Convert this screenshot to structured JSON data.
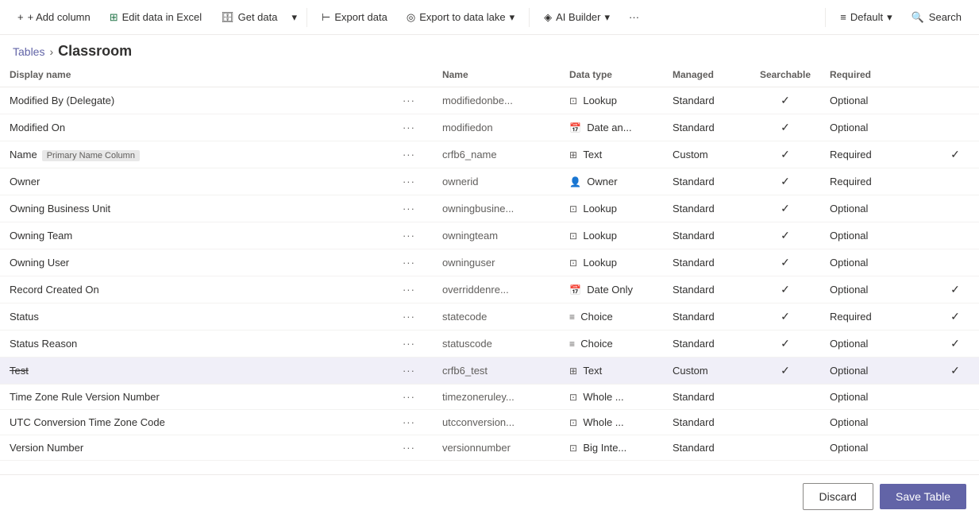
{
  "breadcrumb": {
    "parent": "Tables",
    "separator": "›",
    "current": "Classroom"
  },
  "toolbar": {
    "add_column": "+ Add column",
    "edit_excel": "Edit data in Excel",
    "get_data": "Get data",
    "dropdown": "",
    "export_data": "Export data",
    "export_lake": "Export to data lake",
    "ai_builder": "AI Builder",
    "more": "···",
    "default": "Default",
    "search": "Search"
  },
  "table": {
    "headers": [
      "Display name",
      "",
      "Name",
      "Data type",
      "Managed",
      "Searchable",
      "Required",
      ""
    ],
    "rows": [
      {
        "name": "Modified By (Delegate)",
        "dots": "···",
        "logical": "modifiedonbe...",
        "type_icon": "⊡",
        "type": "Lookup",
        "managed": "Standard",
        "searchable": true,
        "required": "Optional",
        "check2": false,
        "badge": "",
        "strikethrough": false,
        "selected": false
      },
      {
        "name": "Modified On",
        "dots": "···",
        "logical": "modifiedon",
        "type_icon": "📅",
        "type": "Date an...",
        "managed": "Standard",
        "searchable": true,
        "required": "Optional",
        "check2": false,
        "badge": "",
        "strikethrough": false,
        "selected": false
      },
      {
        "name": "Name",
        "dots": "···",
        "logical": "crfb6_name",
        "type_icon": "⊞",
        "type": "Text",
        "managed": "Custom",
        "searchable": true,
        "required": "Required",
        "check2": true,
        "badge": "Primary Name Column",
        "strikethrough": false,
        "selected": false
      },
      {
        "name": "Owner",
        "dots": "···",
        "logical": "ownerid",
        "type_icon": "👤",
        "type": "Owner",
        "managed": "Standard",
        "searchable": true,
        "required": "Required",
        "check2": false,
        "badge": "",
        "strikethrough": false,
        "selected": false
      },
      {
        "name": "Owning Business Unit",
        "dots": "···",
        "logical": "owningbusine...",
        "type_icon": "⊡",
        "type": "Lookup",
        "managed": "Standard",
        "searchable": true,
        "required": "Optional",
        "check2": false,
        "badge": "",
        "strikethrough": false,
        "selected": false
      },
      {
        "name": "Owning Team",
        "dots": "···",
        "logical": "owningteam",
        "type_icon": "⊡",
        "type": "Lookup",
        "managed": "Standard",
        "searchable": true,
        "required": "Optional",
        "check2": false,
        "badge": "",
        "strikethrough": false,
        "selected": false
      },
      {
        "name": "Owning User",
        "dots": "···",
        "logical": "owninguser",
        "type_icon": "⊡",
        "type": "Lookup",
        "managed": "Standard",
        "searchable": true,
        "required": "Optional",
        "check2": false,
        "badge": "",
        "strikethrough": false,
        "selected": false
      },
      {
        "name": "Record Created On",
        "dots": "···",
        "logical": "overriddenre...",
        "type_icon": "📅",
        "type": "Date Only",
        "managed": "Standard",
        "searchable": true,
        "required": "Optional",
        "check2": true,
        "badge": "",
        "strikethrough": false,
        "selected": false
      },
      {
        "name": "Status",
        "dots": "···",
        "logical": "statecode",
        "type_icon": "≡",
        "type": "Choice",
        "managed": "Standard",
        "searchable": true,
        "required": "Required",
        "check2": true,
        "badge": "",
        "strikethrough": false,
        "selected": false
      },
      {
        "name": "Status Reason",
        "dots": "···",
        "logical": "statuscode",
        "type_icon": "≡",
        "type": "Choice",
        "managed": "Standard",
        "searchable": true,
        "required": "Optional",
        "check2": true,
        "badge": "",
        "strikethrough": false,
        "selected": false
      },
      {
        "name": "Test",
        "dots": "···",
        "logical": "crfb6_test",
        "type_icon": "⊞",
        "type": "Text",
        "managed": "Custom",
        "searchable": true,
        "required": "Optional",
        "check2": true,
        "badge": "",
        "strikethrough": true,
        "selected": true
      },
      {
        "name": "Time Zone Rule Version Number",
        "dots": "···",
        "logical": "timezoneruley...",
        "type_icon": "⊡",
        "type": "Whole ...",
        "managed": "Standard",
        "searchable": false,
        "required": "Optional",
        "check2": false,
        "badge": "",
        "strikethrough": false,
        "selected": false
      },
      {
        "name": "UTC Conversion Time Zone Code",
        "dots": "···",
        "logical": "utcconversion...",
        "type_icon": "⊡",
        "type": "Whole ...",
        "managed": "Standard",
        "searchable": false,
        "required": "Optional",
        "check2": false,
        "badge": "",
        "strikethrough": false,
        "selected": false
      },
      {
        "name": "Version Number",
        "dots": "···",
        "logical": "versionnumber",
        "type_icon": "⊡",
        "type": "Big Inte...",
        "managed": "Standard",
        "searchable": false,
        "required": "Optional",
        "check2": false,
        "badge": "",
        "strikethrough": false,
        "selected": false
      }
    ]
  },
  "footer": {
    "discard": "Discard",
    "save": "Save Table"
  }
}
